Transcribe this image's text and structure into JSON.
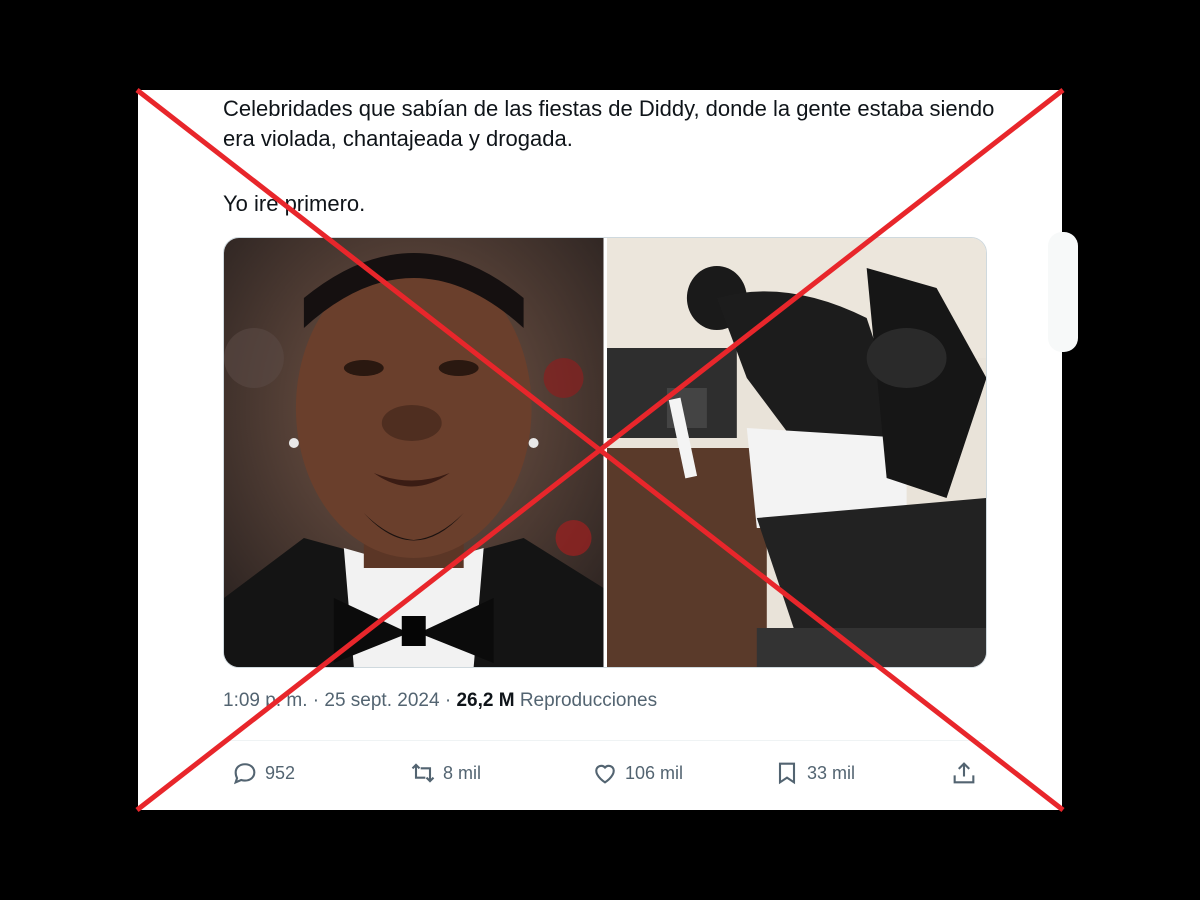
{
  "tweet": {
    "text_line1": "Celebridades que sabían de las fiestas de Diddy, donde la gente estaba siendo era violada, chantajeada y drogada.",
    "text_line2": "Yo ire primero.",
    "media": [
      {
        "alt": "portrait-photo"
      },
      {
        "alt": "courtroom-video-still"
      }
    ],
    "meta": {
      "time": "1:09 p. m.",
      "separator": "·",
      "date": "25 sept. 2024",
      "views_count": "26,2 M",
      "views_label": "Reproducciones"
    },
    "actions": {
      "replies": "952",
      "retweets": "8 mil",
      "likes": "106 mil",
      "bookmarks": "33 mil"
    }
  },
  "overlay": {
    "cross_color": "#e8262b"
  },
  "icons": [
    "reply-icon",
    "retweet-icon",
    "like-icon",
    "bookmark-icon",
    "share-icon"
  ]
}
